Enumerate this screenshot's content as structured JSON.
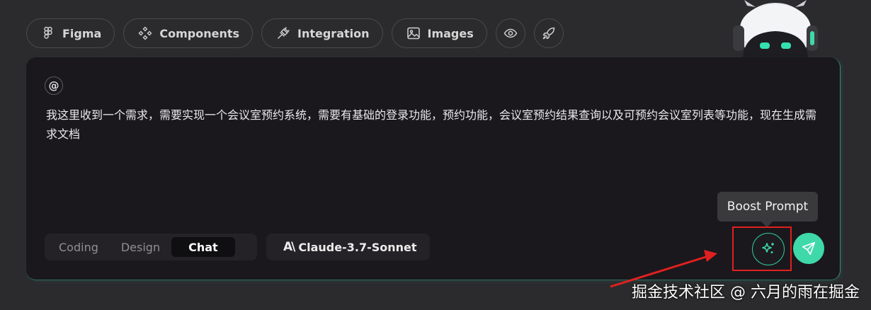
{
  "toolbar": {
    "figma": "Figma",
    "components": "Components",
    "integration": "Integration",
    "images": "Images"
  },
  "input": {
    "mention_symbol": "@",
    "message": "我这里收到一个需求，需要实现一个会议室预约系统，需要有基础的登录功能，预约功能，会议室预约结果查询以及可预约会议室列表等功能，现在生成需求文档"
  },
  "modes": {
    "items": [
      "Coding",
      "Design",
      "Chat"
    ],
    "selected": "Chat"
  },
  "model": {
    "logo": "A\\",
    "name": "Claude-3.7-Sonnet"
  },
  "tooltip": {
    "boost": "Boost Prompt"
  },
  "watermark": "掘金技术社区 @ 六月的雨在掘金",
  "colors": {
    "accent": "#3fd8a8",
    "highlight": "#e02020",
    "background": "#2b2b2d",
    "panel": "#1a181c"
  },
  "icons": {
    "figma": "figma-icon",
    "components": "components-icon",
    "integration": "plug-icon",
    "images": "image-icon",
    "preview": "eye-icon",
    "deploy": "rocket-icon",
    "boost": "sparkle-icon",
    "send": "send-icon"
  }
}
